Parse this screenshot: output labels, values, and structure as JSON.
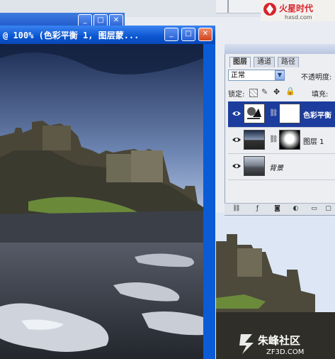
{
  "document_window": {
    "title": "@ 100% (色彩平衡 1, 图层蒙...",
    "buttons": [
      "_",
      "□",
      "✕"
    ]
  },
  "logo": {
    "name": "火星时代",
    "url": "hxsd.com"
  },
  "layers_panel": {
    "tabs": [
      "图层",
      "通道",
      "路径"
    ],
    "blend_mode": "正常",
    "opacity_label": "不透明度:",
    "lock_label": "锁定:",
    "fill_label": "填充:",
    "layers": [
      {
        "name": "色彩平衡",
        "selected": true
      },
      {
        "name": "图层 1",
        "selected": false
      },
      {
        "name": "背景",
        "selected": false
      }
    ]
  },
  "watermark": {
    "text": "朱峰社区",
    "url": "ZF3D.COM"
  }
}
